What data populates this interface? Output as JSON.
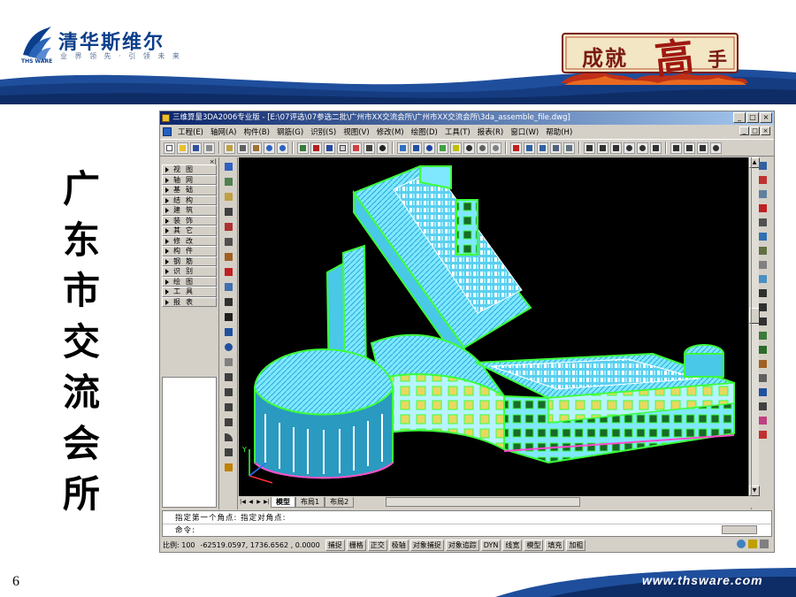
{
  "slide": {
    "logo_title": "清华斯维尔",
    "logo_sub": "业 界 领 先 · 引 领 未 来",
    "logo_ware": "THS WARE",
    "badge_left": "成就",
    "badge_big": "高",
    "badge_small": "手",
    "vertical_title": [
      "广",
      "东",
      "市",
      "交",
      "流",
      "会",
      "所"
    ],
    "page_number": "6",
    "footer_url": "www.thsware.com"
  },
  "app": {
    "title": "三维算量3DA2006专业版 - [E:\\07评选\\07参选二批\\广州市XX交流会所\\广州市XX交流会所\\3da_assemble_file.dwg]",
    "window_buttons": [
      "_",
      "□",
      "×"
    ],
    "menu": [
      "工程(E)",
      "轴网(A)",
      "构件(B)",
      "钢筋(G)",
      "识别(S)",
      "视图(V)",
      "修改(M)",
      "绘图(D)",
      "工具(T)",
      "报表(R)",
      "窗口(W)",
      "帮助(H)"
    ],
    "mdi_buttons": [
      "_",
      "□",
      "×"
    ],
    "left_menu": [
      "视图",
      "轴网",
      "基础",
      "结构",
      "建筑",
      "装饰",
      "其它",
      "修改",
      "构件",
      "钢筋",
      "识别",
      "绘图",
      "工具",
      "报表"
    ],
    "left_menu_close": "×|",
    "tabs": {
      "nav": [
        "|◀",
        "◀",
        "▶",
        "▶|"
      ],
      "items": [
        "模型",
        "布局1",
        "布局2"
      ]
    },
    "command": {
      "line1": "指定第一个角点: 指定对角点:",
      "line2": "命令:"
    },
    "status": {
      "scale": "比例: 100",
      "coords": "-62519.0597, 1736.6562 , 0.0000",
      "buttons": [
        "捕捉",
        "栅格",
        "正交",
        "极轴",
        "对象捕捉",
        "对象追踪",
        "DYN",
        "线宽",
        "模型",
        "填充",
        "加粗"
      ]
    }
  },
  "colors": {
    "brand_blue": "#0b3f8c",
    "titlebar_start": "#0a246a",
    "viewport_bg": "#000000",
    "building_cyan": "#7fe8ff",
    "building_green": "#3cff3c"
  }
}
